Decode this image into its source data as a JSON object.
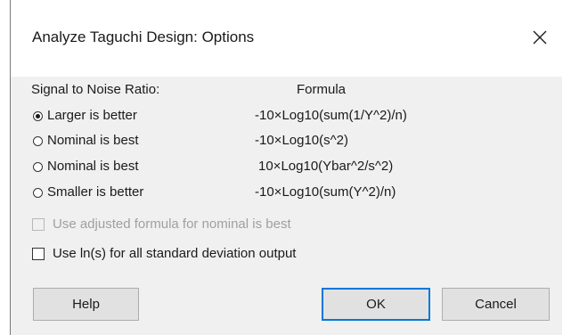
{
  "dialog": {
    "title": "Analyze Taguchi Design: Options",
    "close_glyph": "close-icon"
  },
  "headers": {
    "left": "Signal to Noise Ratio:",
    "right": "Formula"
  },
  "options": [
    {
      "label": "Larger is better",
      "formula": "-10×Log10(sum(1/Y^2)/n)",
      "selected": true
    },
    {
      "label": "Nominal is best",
      "formula": "-10×Log10(s^2)",
      "selected": false
    },
    {
      "label": "Nominal is best",
      "formula": "10×Log10(Ybar^2/s^2)",
      "selected": false
    },
    {
      "label": "Smaller is better",
      "formula": "-10×Log10(sum(Y^2)/n)",
      "selected": false
    }
  ],
  "checkboxes": [
    {
      "label": "Use adjusted formula for nominal is best",
      "checked": false,
      "enabled": false
    },
    {
      "label": "Use ln(s) for all standard deviation output",
      "checked": false,
      "enabled": true
    }
  ],
  "buttons": {
    "help": "Help",
    "ok": "OK",
    "cancel": "Cancel"
  },
  "colors": {
    "accent": "#0078d7",
    "dialog_bg": "#f0f0f0",
    "disabled_text": "#a0a0a0"
  }
}
